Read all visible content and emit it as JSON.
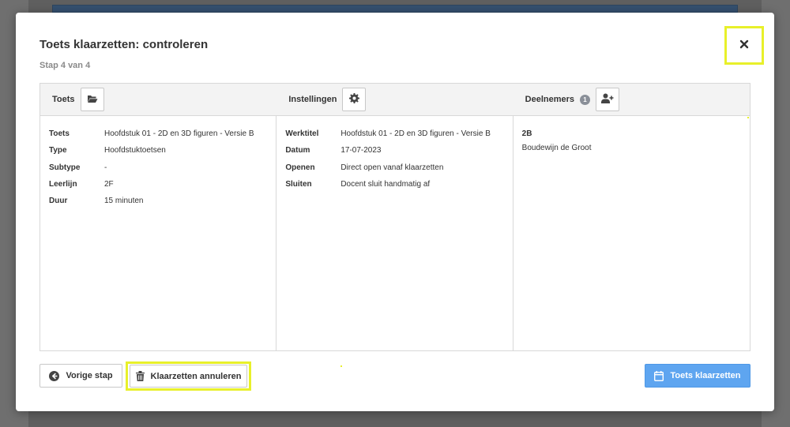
{
  "modal": {
    "title": "Toets klaarzetten: controleren",
    "step": "Stap 4 van 4",
    "close_icon": "close-icon"
  },
  "header": {
    "toets_label": "Toets",
    "instellingen_label": "Instellingen",
    "deelnemers_label": "Deelnemers",
    "deelnemers_count": "1",
    "icons": [
      "folder-open-icon",
      "gear-icon",
      "user-plus-icon"
    ]
  },
  "toets": [
    {
      "label": "Toets",
      "value": "Hoofdstuk 01 - 2D en 3D figuren - Versie B"
    },
    {
      "label": "Type",
      "value": "Hoofdstuktoetsen"
    },
    {
      "label": "Subtype",
      "value": "-"
    },
    {
      "label": "Leerlijn",
      "value": "2F"
    },
    {
      "label": "Duur",
      "value": "15 minuten"
    }
  ],
  "instellingen": [
    {
      "label": "Werktitel",
      "value": "Hoofdstuk 01 - 2D en 3D figuren - Versie B"
    },
    {
      "label": "Datum",
      "value": "17-07-2023"
    },
    {
      "label": "Openen",
      "value": "Direct open vanaf klaarzetten"
    },
    {
      "label": "Sluiten",
      "value": "Docent sluit handmatig af"
    }
  ],
  "deelnemers": {
    "group": "2B",
    "members": [
      "Boudewijn de Groot"
    ]
  },
  "footer": {
    "back_label": "Vorige stap",
    "cancel_label": "Klaarzetten annuleren",
    "submit_label": "Toets klaarzetten",
    "icons": [
      "arrow-left-circle-icon",
      "trash-icon",
      "calendar-icon"
    ]
  },
  "colors": {
    "highlight": "#e8f02a",
    "primary": "#5ea5f0"
  }
}
